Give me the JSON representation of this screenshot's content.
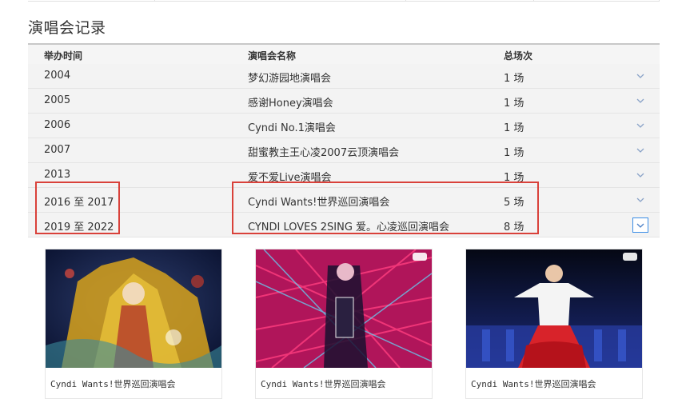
{
  "section": {
    "title": "演唱会记录"
  },
  "table": {
    "headers": {
      "time": "举办时间",
      "name": "演唱会名称",
      "count": "总场次"
    },
    "rows": [
      {
        "time": "2004",
        "name": "梦幻游园地演唱会",
        "count": "1 场"
      },
      {
        "time": "2005",
        "name": "感谢Honey演唱会",
        "count": "1 场"
      },
      {
        "time": "2006",
        "name": "Cyndi No.1演唱会",
        "count": "1 场"
      },
      {
        "time": "2007",
        "name": "甜蜜教主王心凌2007云顶演唱会",
        "count": "1 场"
      },
      {
        "time": "2013",
        "name": "爱不爱Live演唱会",
        "count": "1 场"
      },
      {
        "time": "2016 至 2017",
        "name": "Cyndi Wants!世界巡回演唱会",
        "count": "5 场"
      },
      {
        "time": "2019 至 2022",
        "name": "CYNDI LOVES 2SING 爱。心凌巡回演唱会",
        "count": "8 场"
      }
    ],
    "expand_icon": "chevron-down-icon"
  },
  "highlight_color": "#d9413a",
  "cards": [
    {
      "caption": "Cyndi Wants!世界巡回演唱会"
    },
    {
      "caption": "Cyndi Wants!世界巡回演唱会"
    },
    {
      "caption": "Cyndi Wants!世界巡回演唱会"
    }
  ]
}
